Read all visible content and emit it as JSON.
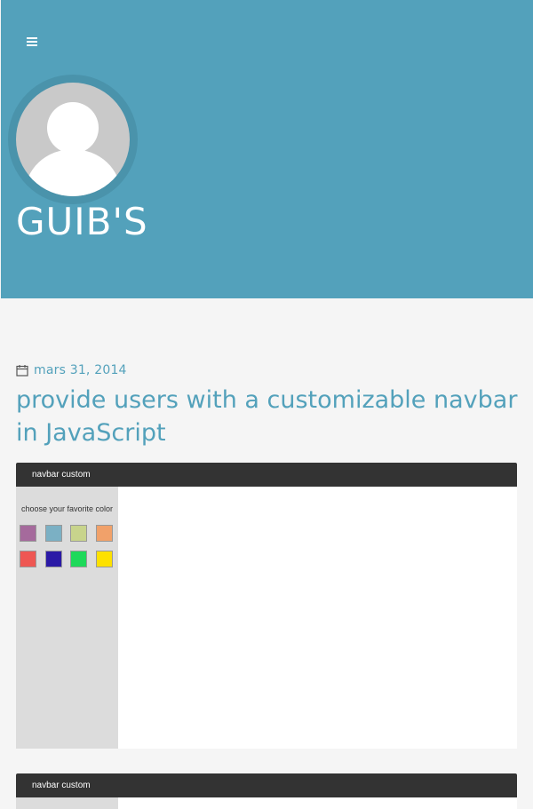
{
  "header": {
    "menu_icon": "hamburger-icon",
    "avatar_icon": "user-avatar-icon",
    "site_title": "GUIB'S",
    "background_color": "#53a1bb"
  },
  "post": {
    "date_icon": "calendar-icon",
    "date": "mars 31, 2014",
    "title": "provide users with a customizable navbar in JavaScript",
    "accent_color": "#53a1bb"
  },
  "screenshots": [
    {
      "navbar_label": "navbar custom",
      "sidebar_label": "choose your favorite color",
      "swatches": [
        "#a56a9c",
        "#7bb0c4",
        "#c8d48c",
        "#f1a16a",
        "#ee5753",
        "#2b1aa6",
        "#1ed95a",
        "#fde100"
      ]
    },
    {
      "navbar_label": "navbar custom"
    }
  ]
}
